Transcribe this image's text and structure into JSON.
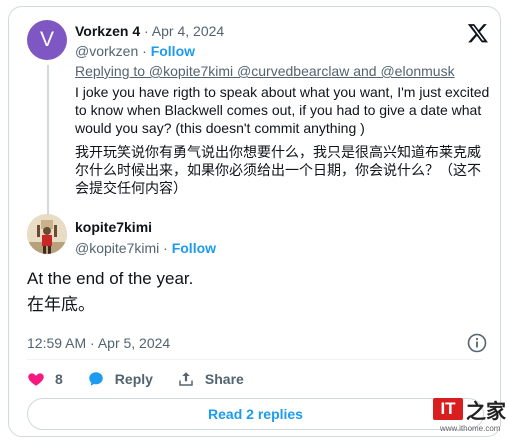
{
  "quoted": {
    "avatar_letter": "V",
    "name": "Vorkzen 4",
    "separator": "·",
    "date": "Apr 4, 2024",
    "handle": "@vorkzen",
    "dot": "·",
    "follow": "Follow",
    "replying_to": "Replying to @kopite7kimi @curvedbearclaw and @elonmusk",
    "body_en": "I joke you have rigth to speak about what you want, I'm just excited to know when Blackwell comes out, if you had to give a date what would you say? (this doesn't commit anything )",
    "body_cn": "我开玩笑说你有勇气说出你想要什么，我只是很高兴知道布莱克威尔什么时候出来，如果你必须给出一个日期，你会说什么？（这不会提交任何内容）"
  },
  "tweet": {
    "name": "kopite7kimi",
    "handle": "@kopite7kimi",
    "dot": "·",
    "follow": "Follow",
    "body_en": "At the end of the year.",
    "body_cn": "在年底。",
    "timestamp": "12:59 AM · Apr 5, 2024"
  },
  "actions": {
    "likes": "8",
    "reply_label": "Reply",
    "share_label": "Share"
  },
  "read_replies": "Read 2 replies",
  "watermark": {
    "it": "IT",
    "home": "之家",
    "url": "www.ithome.com"
  },
  "colors": {
    "accent": "#1d9bf0",
    "like": "#f91880",
    "reply": "#1d9bf0",
    "avatar_bg": "#7e57c2"
  }
}
